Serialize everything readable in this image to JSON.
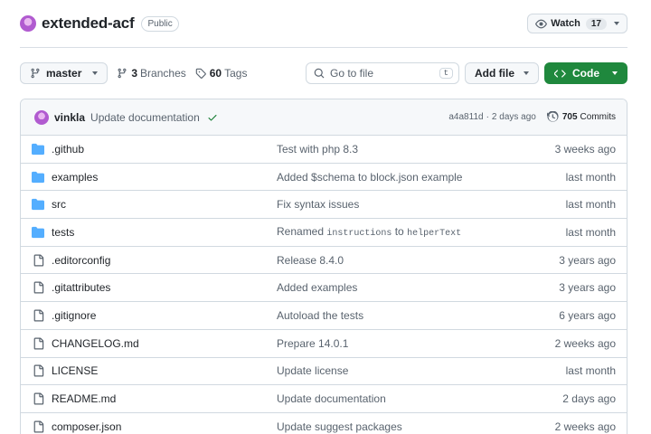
{
  "repo": {
    "name": "extended-acf",
    "visibility": "Public"
  },
  "watch": {
    "label": "Watch",
    "count": "17"
  },
  "toolbar": {
    "branch": "master",
    "branches_count": "3",
    "branches_label": "Branches",
    "tags_count": "60",
    "tags_label": "Tags",
    "search_placeholder": "Go to file",
    "search_shortcut": "t",
    "add_file_label": "Add file",
    "code_label": "Code"
  },
  "latest_commit": {
    "author": "vinkla",
    "message": "Update documentation",
    "status": "success",
    "hash": "a4a811d",
    "separator": "·",
    "time": "2 days ago",
    "commits_count": "705",
    "commits_label": "Commits"
  },
  "files": [
    {
      "name": ".github",
      "type": "folder",
      "message": "Test with php 8.3",
      "date": "3 weeks ago"
    },
    {
      "name": "examples",
      "type": "folder",
      "message": "Added $schema to block.json example",
      "date": "last month"
    },
    {
      "name": "src",
      "type": "folder",
      "message": "Fix syntax issues",
      "date": "last month"
    },
    {
      "name": "tests",
      "type": "folder",
      "message_pre": "Renamed ",
      "message_code1": "instructions",
      "message_mid": " to ",
      "message_code2": "helperText",
      "date": "last month"
    },
    {
      "name": ".editorconfig",
      "type": "file",
      "message": "Release 8.4.0",
      "date": "3 years ago"
    },
    {
      "name": ".gitattributes",
      "type": "file",
      "message": "Added examples",
      "date": "3 years ago"
    },
    {
      "name": ".gitignore",
      "type": "file",
      "message": "Autoload the tests",
      "date": "6 years ago"
    },
    {
      "name": "CHANGELOG.md",
      "type": "file",
      "message": "Prepare 14.0.1",
      "date": "2 weeks ago"
    },
    {
      "name": "LICENSE",
      "type": "file",
      "message": "Update license",
      "date": "last month"
    },
    {
      "name": "README.md",
      "type": "file",
      "message": "Update documentation",
      "date": "2 days ago"
    },
    {
      "name": "composer.json",
      "type": "file",
      "message": "Update suggest packages",
      "date": "2 weeks ago"
    }
  ],
  "colors": {
    "folder": "#54aeff",
    "file_icon": "#59636e",
    "code_button": "#1f883d",
    "success": "#1a7f37"
  }
}
